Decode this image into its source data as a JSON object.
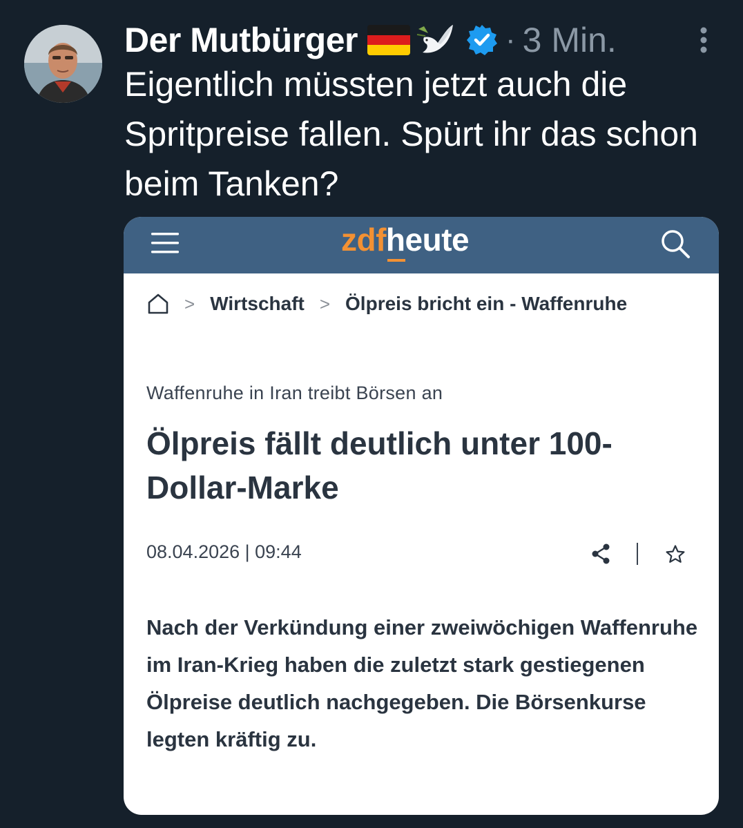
{
  "post": {
    "author_name": "Der Mutbürger",
    "separator": "·",
    "time": "3 Min.",
    "text": "Eigentlich müssten jetzt auch die Spritpreise fallen. Spürt ihr das schon beim Tanken?",
    "icons": {
      "avatar": "avatar-photo",
      "flag": "germany-flag-emoji",
      "dove": "dove-emoji",
      "verified": "verified-badge-icon",
      "more": "more-icon"
    },
    "colors": {
      "background": "#15202b",
      "verified": "#1d9bf0",
      "muted": "#8b98a5"
    }
  },
  "card": {
    "logo_prefix": "zdf",
    "logo_suffix": "heute",
    "breadcrumb": {
      "section": "Wirtschaft",
      "current": "Ölpreis bricht ein - Waffenruhe",
      "separator": ">"
    },
    "kicker": "Waffenruhe in Iran treibt Börsen an",
    "headline": "Ölpreis fällt deutlich unter 100-Dollar-Marke",
    "meta": "08.04.2026 | 09:44",
    "lead": "Nach der Verkündung einer zweiwöchigen Waffenruhe im Iran-Krieg haben die zuletzt stark gestiegenen Ölpreise deutlich nachgegeben. Die Börsenkurse legten kräftig zu.",
    "icons": {
      "menu": "hamburger-menu-icon",
      "search": "search-icon",
      "home": "home-icon",
      "share": "share-icon",
      "bookmark": "star-bookmark-icon"
    },
    "colors": {
      "topbar": "#3f6183",
      "brand_orange": "#f39133",
      "text": "#2a3440"
    }
  }
}
